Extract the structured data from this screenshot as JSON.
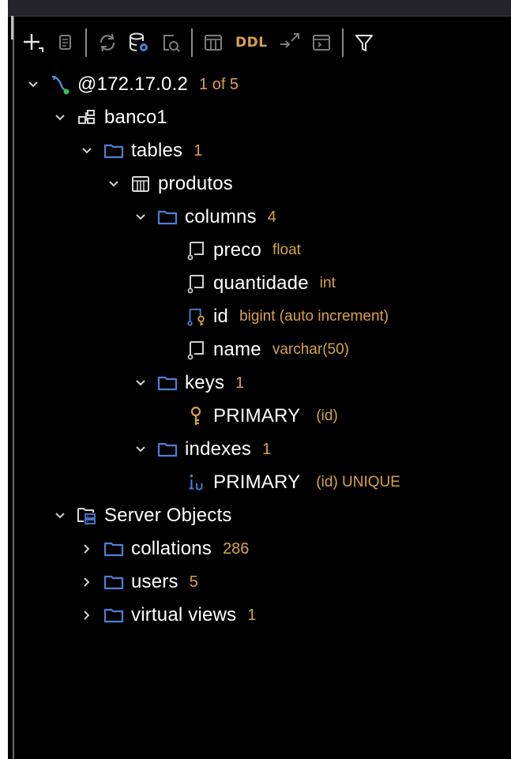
{
  "toolbar": {
    "ddl_label": "DDL",
    "icons": [
      "add-icon",
      "copy-icon",
      "refresh-icon",
      "database-settings-icon",
      "query-console-icon",
      "table-icon",
      "ddl-icon",
      "jump-icon",
      "console-icon",
      "filter-icon"
    ]
  },
  "tree": {
    "connection": {
      "label": "@172.17.0.2",
      "meta": "1 of 5"
    },
    "schema": {
      "label": "banco1"
    },
    "tables": {
      "label": "tables",
      "meta": "1"
    },
    "table": {
      "label": "produtos"
    },
    "columns": {
      "label": "columns",
      "meta": "4",
      "items": [
        {
          "label": "preco",
          "type": "float"
        },
        {
          "label": "quantidade",
          "type": "int"
        },
        {
          "label": "id",
          "type": "bigint (auto increment)"
        },
        {
          "label": "name",
          "type": "varchar(50)"
        }
      ]
    },
    "keys": {
      "label": "keys",
      "meta": "1",
      "items": [
        {
          "label": "PRIMARY",
          "detail": "(id)"
        }
      ]
    },
    "indexes": {
      "label": "indexes",
      "meta": "1",
      "items": [
        {
          "label": "PRIMARY",
          "detail": "(id) UNIQUE"
        }
      ]
    },
    "server_objects": {
      "label": "Server Objects",
      "items": [
        {
          "label": "collations",
          "meta": "286"
        },
        {
          "label": "users",
          "meta": "5"
        },
        {
          "label": "virtual views",
          "meta": "1"
        }
      ]
    }
  },
  "colors": {
    "background": "#000000",
    "text": "#ffffff",
    "meta": "#d8a24a",
    "folder": "#4f7fd6",
    "icon_gray": "#c8c8c8",
    "key": "#d8a24a"
  }
}
